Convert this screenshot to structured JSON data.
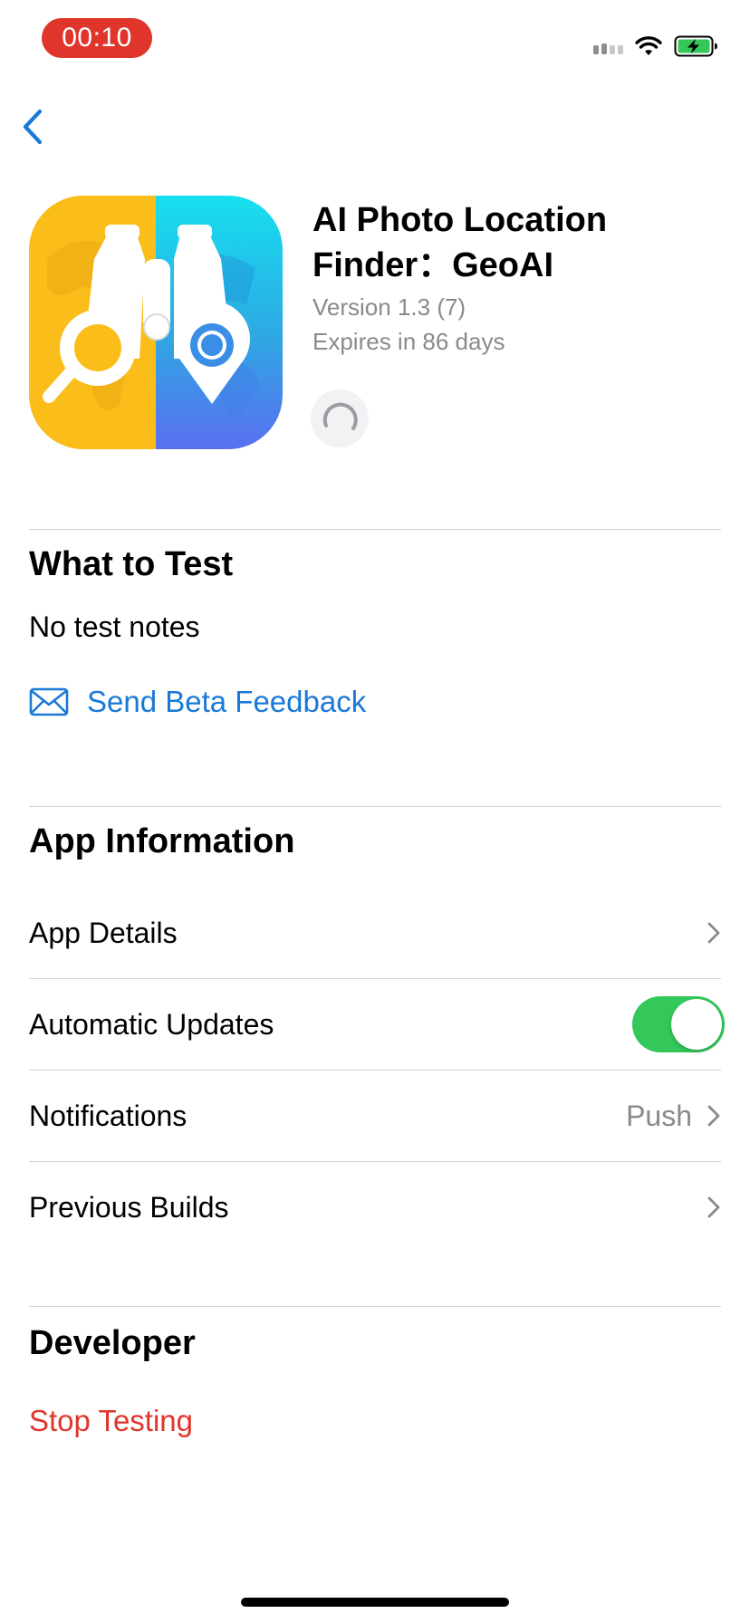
{
  "status_bar": {
    "time": "00:10",
    "icons": [
      "cellular-signal-icon",
      "wifi-icon",
      "battery-charging-icon"
    ],
    "pill_color": "#e0352b",
    "battery_color": "#34c759"
  },
  "nav": {
    "back_icon": "chevron-left-icon"
  },
  "app": {
    "title": "AI Photo Location Finder：GeoAI",
    "version": "Version 1.3 (7)",
    "expires": "Expires in 86 days",
    "icon": "binoculars-map-pin-icon"
  },
  "what_to_test": {
    "heading": "What to Test",
    "notes": "No test notes",
    "feedback_label": "Send Beta Feedback",
    "feedback_icon": "envelope-icon"
  },
  "app_information": {
    "heading": "App Information",
    "rows": [
      {
        "label": "App Details",
        "value": "",
        "control": "chevron"
      },
      {
        "label": "Automatic Updates",
        "value": "",
        "control": "toggle",
        "toggle_on": true
      },
      {
        "label": "Notifications",
        "value": "Push",
        "control": "chevron"
      },
      {
        "label": "Previous Builds",
        "value": "",
        "control": "chevron"
      }
    ]
  },
  "developer": {
    "heading": "Developer",
    "stop_testing_label": "Stop Testing"
  },
  "colors": {
    "accent": "#1a78d7",
    "destructive": "#e0352b",
    "toggle_on": "#34c759",
    "secondary_text": "#8a8a8e"
  }
}
